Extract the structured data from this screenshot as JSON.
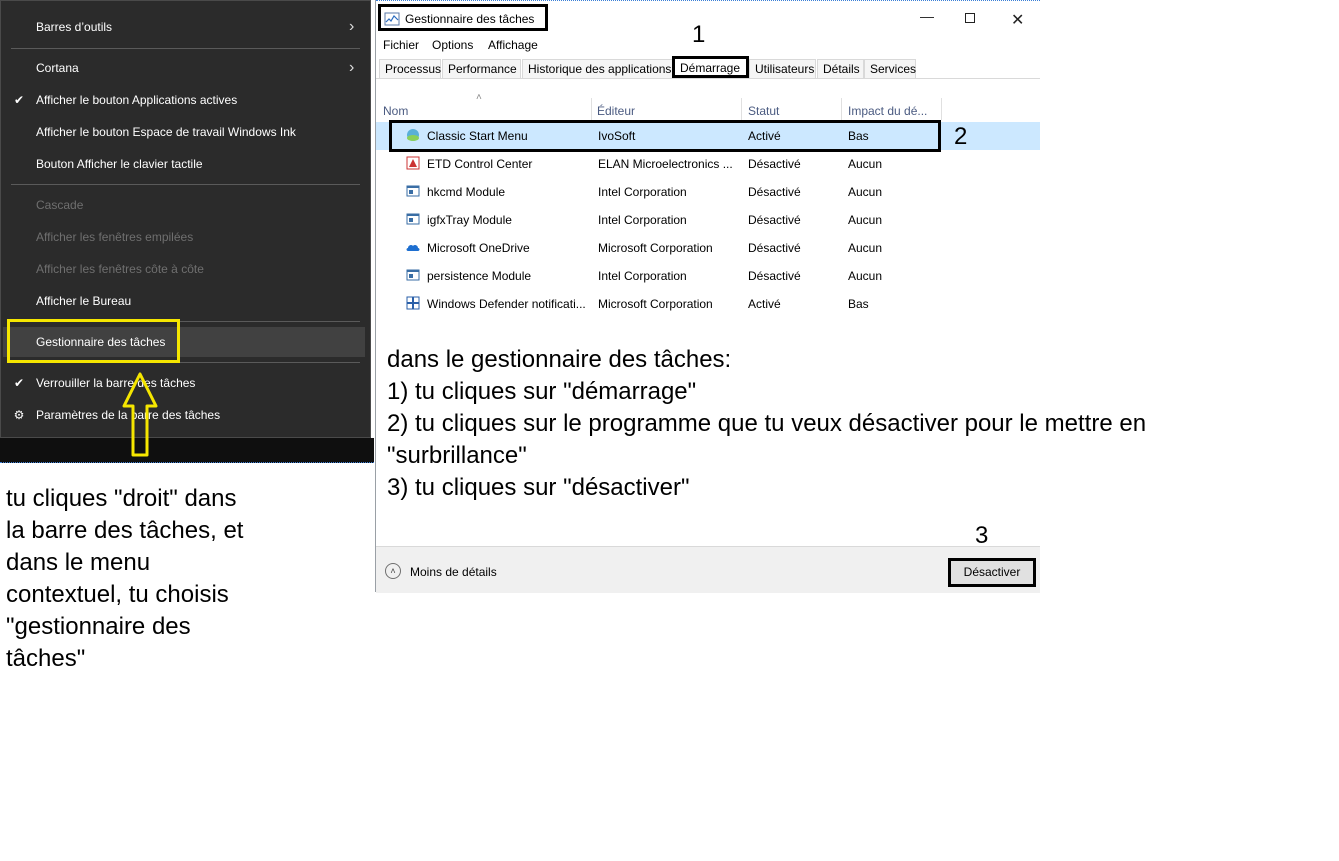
{
  "context_menu": {
    "items": [
      {
        "label": "Barres d’outils",
        "submenu": true
      },
      {
        "label": "Cortana",
        "submenu": true
      },
      {
        "label": "Afficher le bouton Applications actives",
        "checked": true
      },
      {
        "label": "Afficher le bouton Espace de travail Windows Ink"
      },
      {
        "label": "Bouton Afficher le clavier tactile"
      },
      {
        "label": "Cascade",
        "disabled": true
      },
      {
        "label": "Afficher les fenêtres empilées",
        "disabled": true
      },
      {
        "label": "Afficher les fenêtres côte à côte",
        "disabled": true
      },
      {
        "label": "Afficher le Bureau"
      },
      {
        "label": "Gestionnaire des tâches",
        "highlighted": true
      },
      {
        "label": "Verrouiller la barre des tâches",
        "checked": true
      },
      {
        "label": "Paramètres de la barre des tâches",
        "icon": "gear-icon"
      }
    ]
  },
  "task_manager": {
    "title": "Gestionnaire des tâches",
    "menu": [
      "Fichier",
      "Options",
      "Affichage"
    ],
    "tabs": [
      "Processus",
      "Performance",
      "Historique des applications",
      "Démarrage",
      "Utilisateurs",
      "Détails",
      "Services"
    ],
    "active_tab": "Démarrage",
    "columns": [
      "Nom",
      "Éditeur",
      "Statut",
      "Impact du dé..."
    ],
    "rows": [
      {
        "name": "Classic Start Menu",
        "publisher": "IvoSoft",
        "status": "Activé",
        "impact": "Bas",
        "icon": "shell-icon"
      },
      {
        "name": "ETD Control Center",
        "publisher": "ELAN Microelectronics ...",
        "status": "Désactivé",
        "impact": "Aucun",
        "icon": "elan-icon"
      },
      {
        "name": "hkcmd Module",
        "publisher": "Intel Corporation",
        "status": "Désactivé",
        "impact": "Aucun",
        "icon": "module-icon"
      },
      {
        "name": "igfxTray Module",
        "publisher": "Intel Corporation",
        "status": "Désactivé",
        "impact": "Aucun",
        "icon": "module-icon"
      },
      {
        "name": "Microsoft OneDrive",
        "publisher": "Microsoft Corporation",
        "status": "Désactivé",
        "impact": "Aucun",
        "icon": "onedrive-icon"
      },
      {
        "name": "persistence Module",
        "publisher": "Intel Corporation",
        "status": "Désactivé",
        "impact": "Aucun",
        "icon": "module-icon"
      },
      {
        "name": "Windows Defender notificati...",
        "publisher": "Microsoft Corporation",
        "status": "Activé",
        "impact": "Bas",
        "icon": "defender-icon"
      }
    ],
    "footer": {
      "less_details": "Moins de détails",
      "disable_button": "Désactiver"
    }
  },
  "annotations": {
    "numbers": [
      "1",
      "2",
      "3"
    ],
    "instructions": [
      "dans le gestionnaire des tâches:",
      "1) tu cliques sur \"démarrage\"",
      "2) tu cliques sur le programme que tu veux désactiver pour le mettre en",
      "\"surbrillance\"",
      "3) tu cliques sur \"désactiver\""
    ],
    "left_instructions": "tu cliques \"droit\" dans la barre des tâches, et dans le menu contextuel, tu choisis \"gestionnaire des tâches\"",
    "colors": {
      "highlight": "#ffff00",
      "callout": "#000000",
      "selection": "#cce8ff"
    }
  }
}
